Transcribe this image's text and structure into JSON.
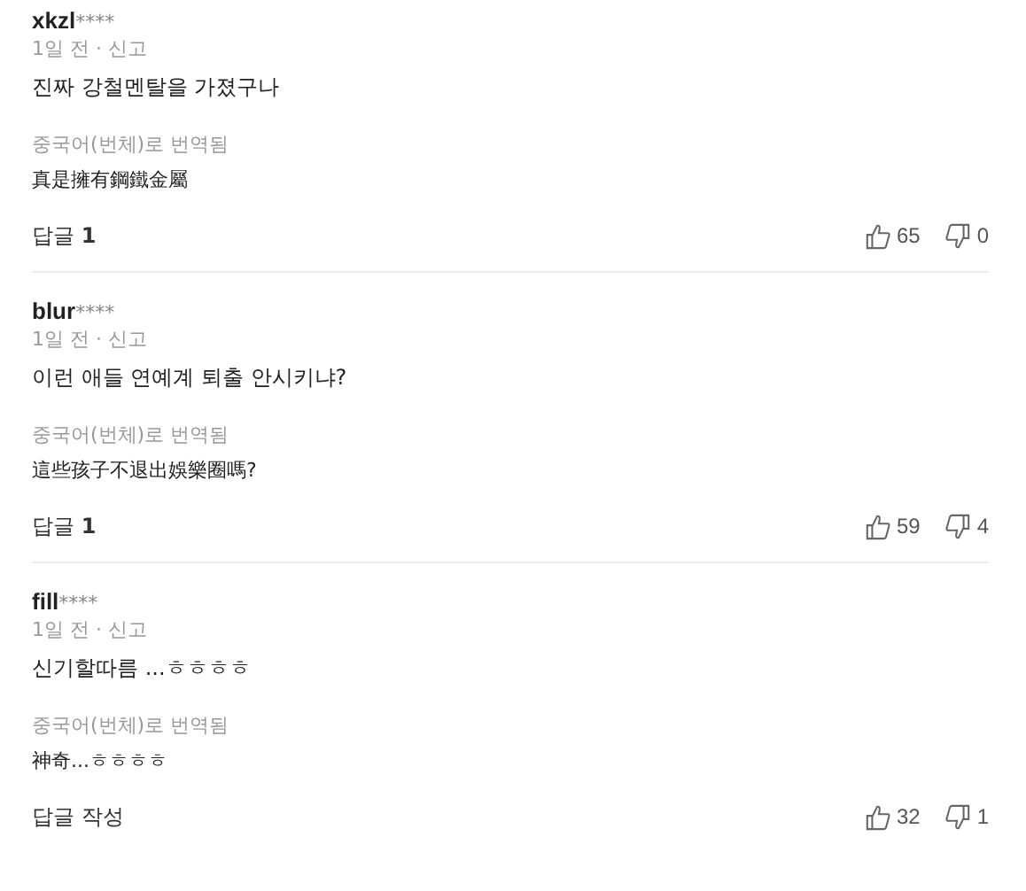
{
  "comments": [
    {
      "username": "xkzl",
      "masked": "****",
      "meta": "1일 전 · 신고",
      "text": "진짜 강철멘탈을 가졌구나",
      "translation_label": "중국어(번체)로 번역됨",
      "translation": "真是擁有鋼鐵金屬",
      "reply": "답글 **1**",
      "likes": "65",
      "dislikes": "0"
    },
    {
      "username": "blur",
      "masked": "****",
      "meta": "1일 전 · 신고",
      "text": "이런 애들 연예계 퇴출 안시키냐?",
      "translation_label": "중국어(번체)로 번역됨",
      "translation": "這些孩子不退出娛樂圈嗎?",
      "reply": "답글 **1**",
      "likes": "59",
      "dislikes": "4"
    },
    {
      "username": "fill",
      "masked": "****",
      "meta": "1일 전 · 신고",
      "text": "신기할따름 ...ㅎㅎㅎㅎ",
      "translation_label": "중국어(번체)로 번역됨",
      "translation": "神奇...ㅎㅎㅎㅎ",
      "reply": "답글 작성",
      "likes": "32",
      "dislikes": "1"
    }
  ]
}
